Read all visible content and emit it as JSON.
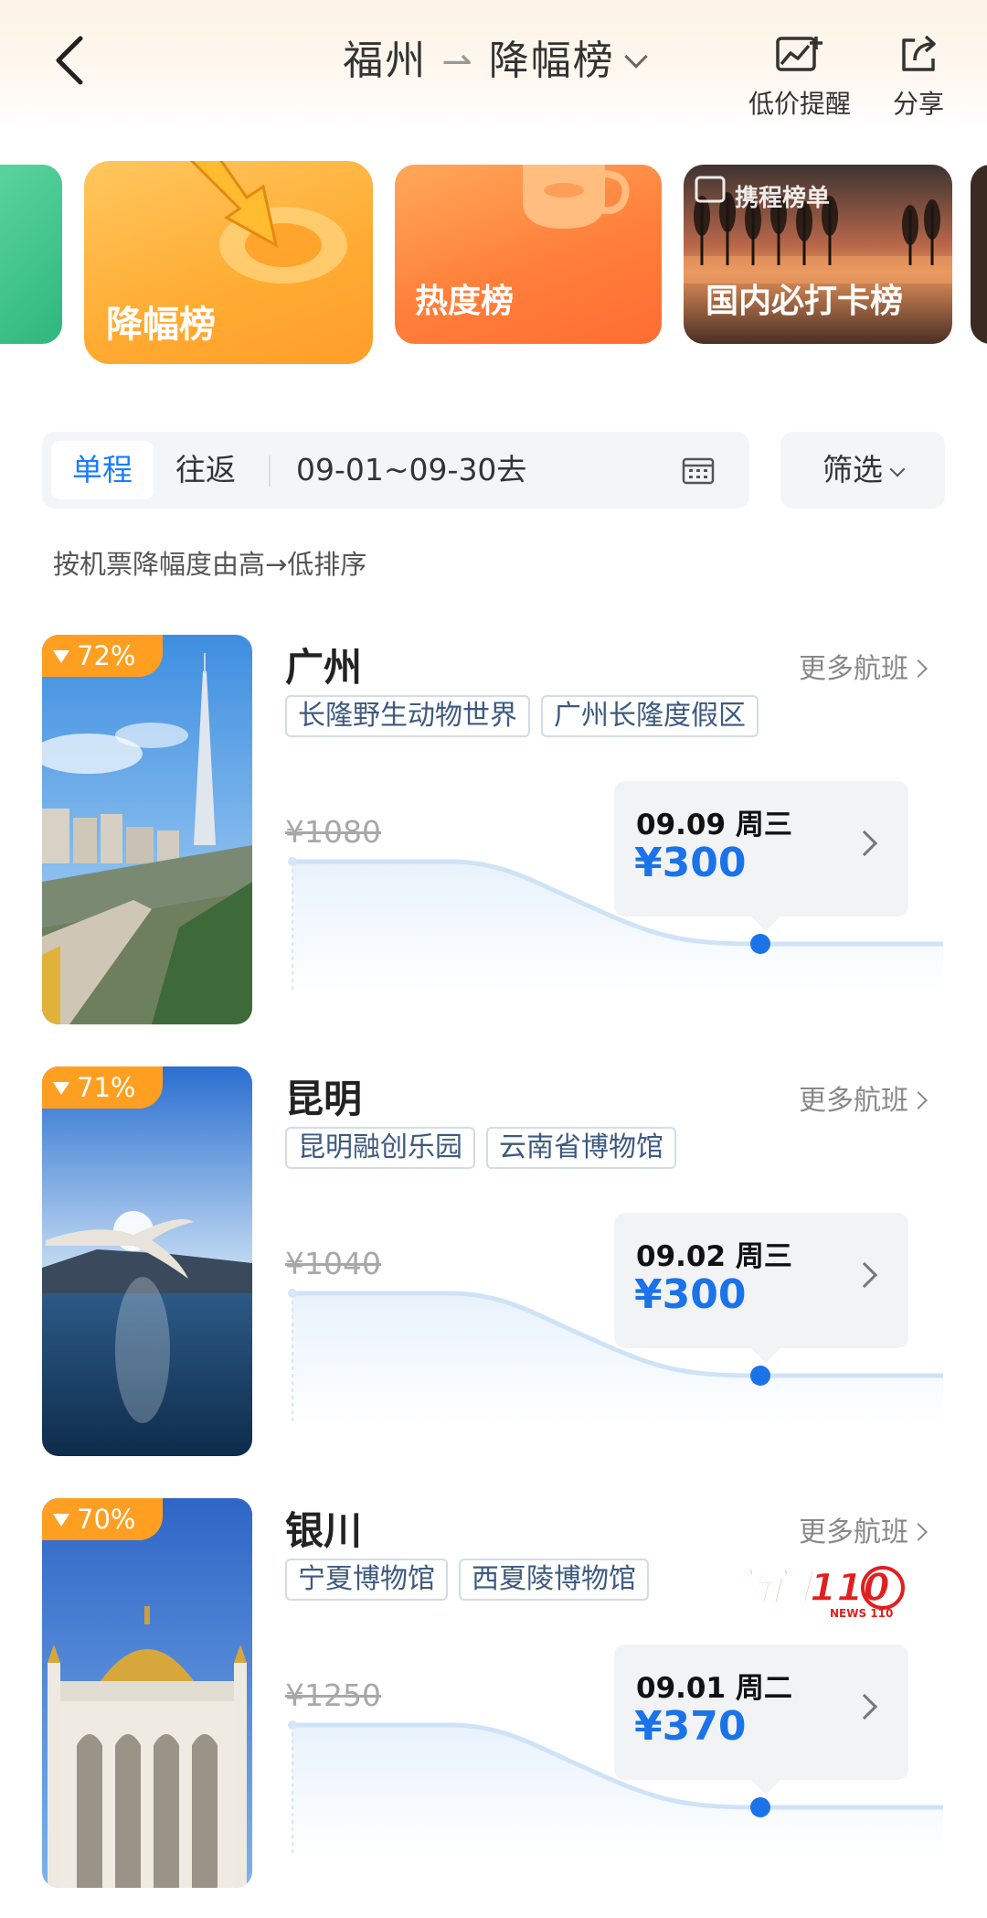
{
  "header": {
    "origin": "福州",
    "arrow": "⇀",
    "list_name": "降幅榜",
    "price_alert_label": "低价提醒",
    "share_label": "分享"
  },
  "categories": [
    {
      "label": "降幅榜"
    },
    {
      "label": "热度榜"
    },
    {
      "label": "国内必打卡榜",
      "brand": "携程榜单"
    }
  ],
  "filter": {
    "one_way": "单程",
    "round_trip": "往返",
    "dates": "09-01~09-30去",
    "screen": "筛选"
  },
  "sort_note": "按机票降幅度由高→低排序",
  "destinations": [
    {
      "drop": "72%",
      "city": "广州",
      "more": "更多航班",
      "tags": [
        "长隆野生动物世界",
        "广州长隆度假区"
      ],
      "old_price": "¥1080",
      "date": "09.09 周三",
      "price": "¥300"
    },
    {
      "drop": "71%",
      "city": "昆明",
      "more": "更多航班",
      "tags": [
        "昆明融创乐园",
        "云南省博物馆"
      ],
      "old_price": "¥1040",
      "date": "09.02 周三",
      "price": "¥300"
    },
    {
      "drop": "70%",
      "city": "银川",
      "more": "更多航班",
      "tags": [
        "宁夏博物馆",
        "西夏陵博物馆"
      ],
      "old_price": "¥1250",
      "date": "09.01 周二",
      "price": "¥370"
    }
  ],
  "colors": {
    "accent_blue": "#1a73e8",
    "drop_orange": "#ff9f22"
  },
  "watermark": {
    "text": "新闻110",
    "sub": "NEWS 110"
  }
}
